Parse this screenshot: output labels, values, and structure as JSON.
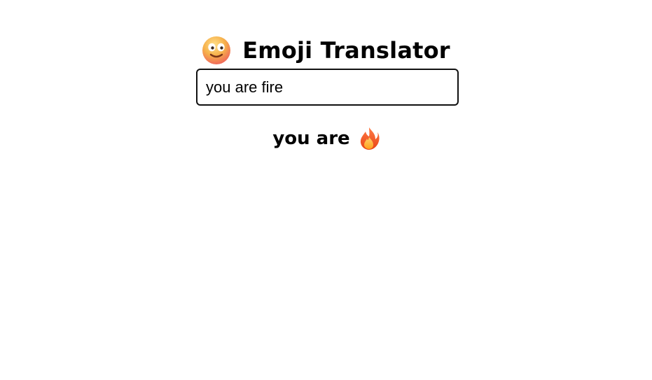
{
  "app": {
    "title": "Emoji Translator",
    "logo_icon": "smiling-face-icon"
  },
  "translator": {
    "input_value": "you are fire"
  },
  "result": {
    "text": "you are",
    "emoji_icon": "fire-icon"
  },
  "colors": {
    "text": "#000000",
    "background": "#ffffff",
    "input_border": "#111111",
    "emoji_face": "#f6b04a",
    "fire_outer": "#f15a24",
    "fire_inner": "#ffb000"
  }
}
